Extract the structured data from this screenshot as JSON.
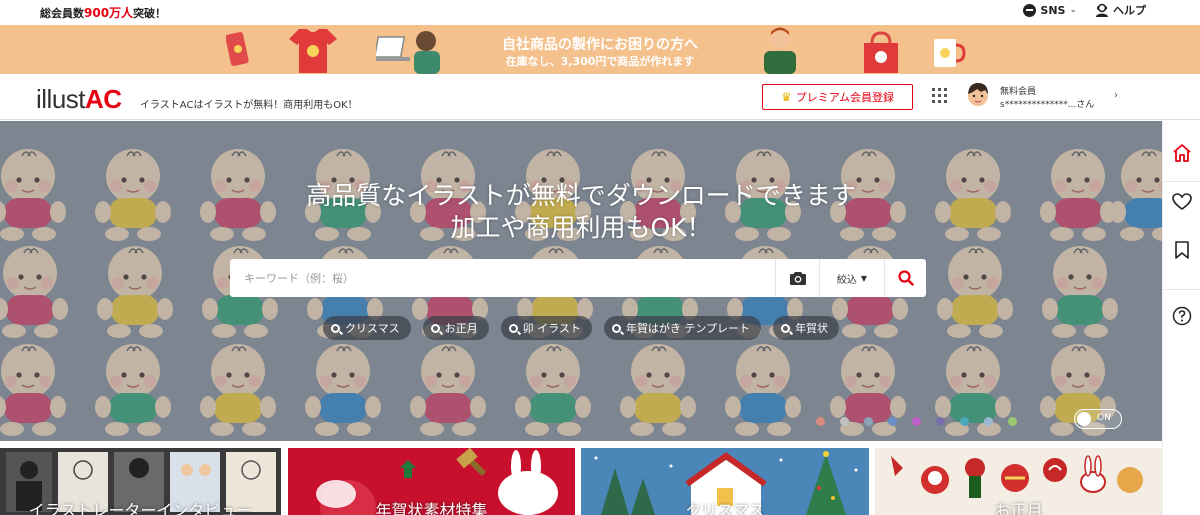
{
  "top": {
    "members_prefix": "総会員数",
    "members_count": "900万人",
    "members_suffix": "突破！",
    "sns_label": "SNS",
    "help_label": "ヘルプ"
  },
  "banner": {
    "line1": "自社商品の製作にお困りの方へ",
    "line2": "在庫なし、3,300円で商品が作れます"
  },
  "header": {
    "logo_text": "illust",
    "logo_accent": "AC",
    "tagline": "イラストACはイラストが無料！商用利用もOK！",
    "premium_label": "プレミアム会員登録",
    "user_tier": "無料会員",
    "user_name": "s**************...さん"
  },
  "hero": {
    "title_line1": "高品質なイラストが無料でダウンロードできます",
    "title_line2": "加工や商用利用もOK！",
    "search_placeholder": "キーワード（例：桜）",
    "filter_label": "絞込",
    "tags": [
      "クリスマス",
      "お正月",
      "卯 イラスト",
      "年賀はがき テンプレート",
      "年賀状"
    ],
    "toggle_label": "ON",
    "dot_colors": [
      "#d98a7e",
      "#bfbfbf",
      "#8aa4b8",
      "#6d8fc7",
      "#c05fc7",
      "#7a6fa8",
      "#4aa8b8",
      "#9ab8d0",
      "#9bc86c"
    ]
  },
  "cards": [
    {
      "caption": "イラストレーターインタビュー",
      "bg": "#3a3a3a"
    },
    {
      "caption": "年賀状素材特集",
      "bg": "#c8102e"
    },
    {
      "caption": "クリスマス",
      "bg": "#4b86b8"
    },
    {
      "caption": "お正月",
      "bg": "#f3ede4"
    }
  ],
  "colors": {
    "accent": "#e60012",
    "banner": "#f4c18d",
    "hero_bg": "#7f8792"
  }
}
